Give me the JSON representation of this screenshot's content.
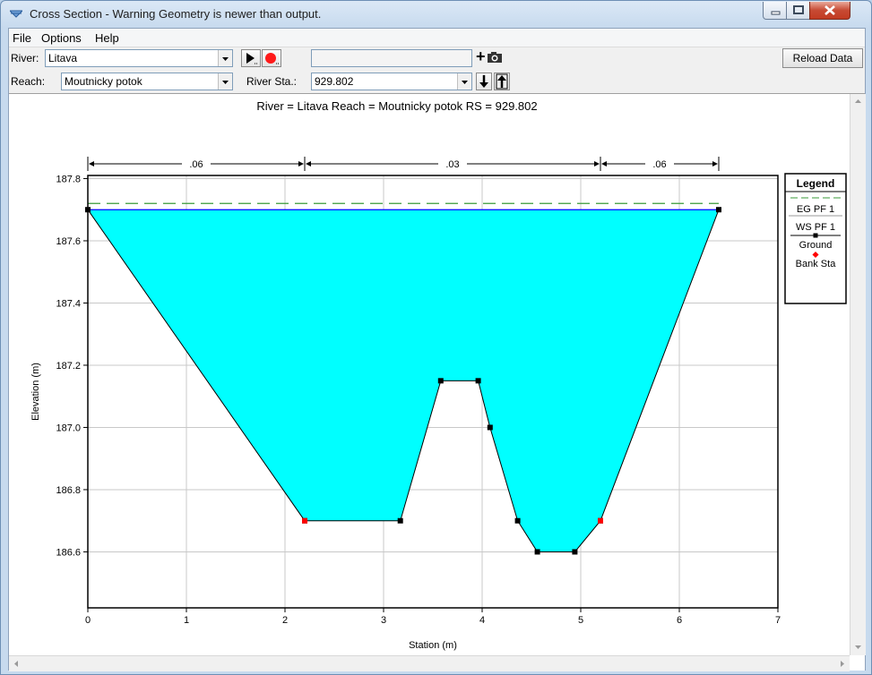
{
  "window": {
    "title": "Cross Section - Warning Geometry is newer than output."
  },
  "menu": [
    "File",
    "Options",
    "Help"
  ],
  "toolbar": {
    "river_label": "River:",
    "river_value": "Litava",
    "reach_label": "Reach:",
    "reach_value": "Moutnicky potok",
    "river_sta_label": "River Sta.:",
    "river_sta_value": "929.802",
    "reload_label": "Reload Data",
    "plus_label": "+"
  },
  "chart_data": {
    "type": "line",
    "title": "River = Litava   Reach = Moutnicky potok      RS = 929.802",
    "xlabel": "Station (m)",
    "ylabel": "Elevation (m)",
    "xlim": [
      0,
      7
    ],
    "ylim": [
      186.42,
      187.81
    ],
    "xticks": [
      "0",
      "1",
      "2",
      "3",
      "4",
      "5",
      "6",
      "7"
    ],
    "yticks": [
      "186.6",
      "186.8",
      "187.0",
      "187.2",
      "187.4",
      "187.6",
      "187.8"
    ],
    "ytick_values": [
      186.6,
      186.8,
      187.0,
      187.2,
      187.4,
      187.6,
      187.8
    ],
    "grid": true,
    "manning": [
      {
        "label": ".06",
        "from": 0,
        "to": 2.2
      },
      {
        "label": ".03",
        "from": 2.2,
        "to": 5.2
      },
      {
        "label": ".06",
        "from": 5.2,
        "to": 6.4
      }
    ],
    "series": [
      {
        "name": "EG PF 1",
        "color": "#3a9a3a",
        "style": "dashed",
        "x": [
          0,
          6.4
        ],
        "y": [
          187.72,
          187.72
        ]
      },
      {
        "name": "WS PF 1",
        "color": "#0000ff",
        "x": [
          0,
          6.4
        ],
        "y": [
          187.7,
          187.7
        ]
      },
      {
        "name": "Ground",
        "color": "#000000",
        "x": [
          0,
          2.2,
          3.17,
          3.58,
          3.96,
          4.08,
          4.36,
          4.56,
          4.94,
          5.2,
          6.4
        ],
        "y": [
          187.7,
          186.7,
          186.7,
          187.15,
          187.15,
          187.0,
          186.7,
          186.6,
          186.6,
          186.7,
          187.7
        ]
      },
      {
        "name": "Bank Sta",
        "color": "#ff0000",
        "x": [
          2.2,
          5.2
        ],
        "y": [
          186.7,
          186.7
        ]
      }
    ],
    "water_fill": "#00ffff",
    "legend": {
      "title": "Legend",
      "position": "right",
      "items": [
        "EG PF 1",
        "WS PF 1",
        "Ground",
        "Bank Sta"
      ]
    }
  }
}
